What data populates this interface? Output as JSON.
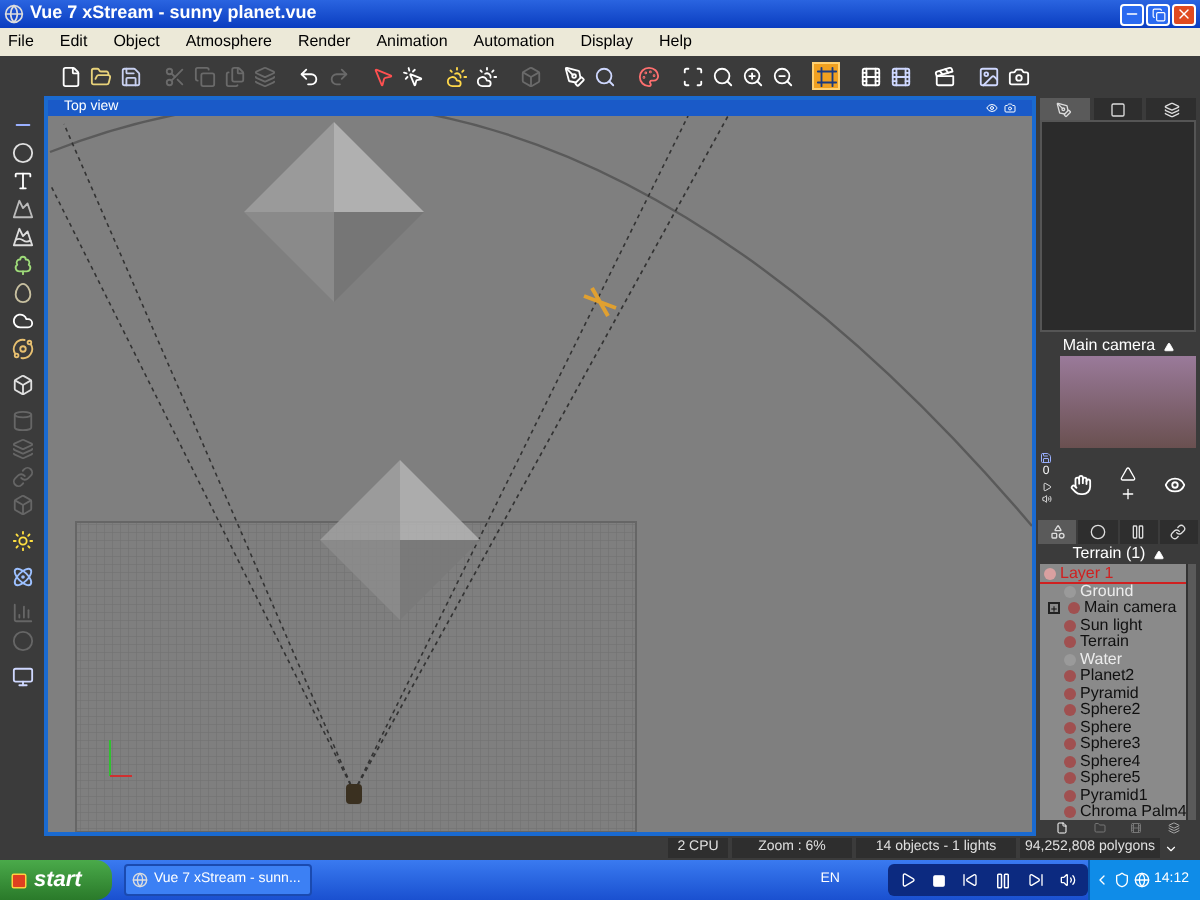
{
  "window": {
    "title": "Vue 7 xStream - sunny planet.vue"
  },
  "menu": [
    "File",
    "Edit",
    "Object",
    "Atmosphere",
    "Render",
    "Animation",
    "Automation",
    "Display",
    "Help"
  ],
  "toolbar": [
    {
      "buttons": [
        {
          "disabled": false,
          "selected": false
        },
        {
          "disabled": false,
          "selected": false
        },
        {
          "disabled": false,
          "selected": false
        }
      ]
    },
    {
      "buttons": [
        {
          "disabled": true,
          "selected": false
        },
        {
          "disabled": true,
          "selected": false
        },
        {
          "disabled": true,
          "selected": false
        },
        {
          "disabled": true,
          "selected": false
        }
      ]
    },
    {
      "buttons": [
        {
          "disabled": false,
          "selected": false
        },
        {
          "disabled": true,
          "selected": false
        }
      ]
    },
    {
      "buttons": [
        {
          "disabled": false,
          "selected": false
        },
        {
          "disabled": false,
          "selected": false
        }
      ]
    },
    {
      "buttons": [
        {
          "disabled": false,
          "selected": false
        },
        {
          "disabled": false,
          "selected": false
        }
      ]
    },
    {
      "buttons": [
        {
          "disabled": true,
          "selected": false
        }
      ]
    },
    {
      "buttons": [
        {
          "disabled": false,
          "selected": false
        },
        {
          "disabled": false,
          "selected": false
        }
      ]
    },
    {
      "buttons": [
        {
          "disabled": false,
          "selected": false
        }
      ]
    },
    {
      "buttons": [
        {
          "disabled": false,
          "selected": false
        },
        {
          "disabled": false,
          "selected": false
        },
        {
          "disabled": false,
          "selected": false
        },
        {
          "disabled": false,
          "selected": false
        }
      ]
    },
    {
      "buttons": [
        {
          "disabled": false,
          "selected": true
        }
      ]
    },
    {
      "buttons": [
        {
          "disabled": false,
          "selected": false
        },
        {
          "disabled": false,
          "selected": false
        }
      ]
    },
    {
      "buttons": [
        {
          "disabled": false,
          "selected": false
        }
      ]
    },
    {
      "buttons": [
        {
          "disabled": false,
          "selected": false
        },
        {
          "disabled": false,
          "selected": false
        }
      ]
    }
  ],
  "left_tools": [
    {
      "tools": [
        {
          "disabled": false
        },
        {
          "disabled": false
        },
        {
          "disabled": false
        },
        {
          "disabled": false
        },
        {
          "disabled": false
        },
        {
          "disabled": false
        },
        {
          "disabled": false
        },
        {
          "disabled": false
        },
        {
          "disabled": false
        }
      ]
    },
    {
      "tools": [
        {
          "disabled": false
        }
      ]
    },
    {
      "tools": [
        {
          "disabled": true
        },
        {
          "disabled": true
        },
        {
          "disabled": true
        },
        {
          "disabled": true
        }
      ]
    },
    {
      "tools": [
        {
          "disabled": false
        }
      ]
    },
    {
      "tools": [
        {
          "disabled": false
        }
      ]
    },
    {
      "tools": [
        {
          "disabled": true
        },
        {
          "disabled": true
        }
      ]
    },
    {
      "tools": [
        {
          "disabled": false
        }
      ]
    }
  ],
  "viewport": {
    "title": "Top view"
  },
  "view_tabs": [
    {
      "selected": true
    },
    {
      "selected": false
    },
    {
      "selected": false
    }
  ],
  "camera_panel": {
    "title": "Main camera",
    "frame": "0"
  },
  "object_tabs": [
    {
      "selected": true
    },
    {
      "selected": false
    },
    {
      "selected": false
    },
    {
      "selected": false
    }
  ],
  "layer_panel": {
    "title": "Terrain (1)"
  },
  "tree": [
    {
      "label": "Layer 1",
      "selected": true,
      "expanded": true,
      "dimmed": false,
      "children": [
        {
          "label": "Ground",
          "dimmed": true,
          "selected": false
        },
        {
          "label": "Main camera",
          "dimmed": false,
          "selected": false,
          "expanded": false
        },
        {
          "label": "Sun light",
          "dimmed": false,
          "selected": false
        },
        {
          "label": "Terrain",
          "dimmed": false,
          "selected": false
        },
        {
          "label": "Water",
          "dimmed": true,
          "selected": false
        },
        {
          "label": "Planet2",
          "dimmed": false,
          "selected": false
        },
        {
          "label": "Pyramid",
          "dimmed": false,
          "selected": false
        },
        {
          "label": "Sphere2",
          "dimmed": false,
          "selected": false
        },
        {
          "label": "Sphere",
          "dimmed": false,
          "selected": false
        },
        {
          "label": "Sphere3",
          "dimmed": false,
          "selected": false
        },
        {
          "label": "Sphere4",
          "dimmed": false,
          "selected": false
        },
        {
          "label": "Sphere5",
          "dimmed": false,
          "selected": false
        },
        {
          "label": "Pyramid1",
          "dimmed": false,
          "selected": false
        },
        {
          "label": "Chroma Palm4",
          "dimmed": false,
          "selected": false
        }
      ]
    }
  ],
  "status_bar": {
    "cpu": "2 CPU",
    "zoom": "Zoom : 6%",
    "objects": "14 objects - 1 lights",
    "polygons": "94,252,808 polygons"
  },
  "taskbar": {
    "start": "start",
    "task": "Vue 7 xStream - sunn...",
    "language": "EN",
    "clock": "14:12"
  }
}
